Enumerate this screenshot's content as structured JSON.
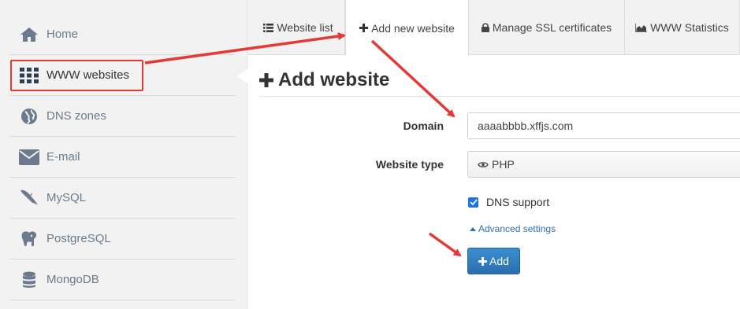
{
  "sidebar": {
    "items": [
      {
        "label": "Home",
        "icon": "home-icon"
      },
      {
        "label": "WWW websites",
        "icon": "grid-icon",
        "active": true
      },
      {
        "label": "DNS zones",
        "icon": "globe-icon"
      },
      {
        "label": "E-mail",
        "icon": "envelope-icon"
      },
      {
        "label": "MySQL",
        "icon": "dolphin-icon"
      },
      {
        "label": "PostgreSQL",
        "icon": "elephant-icon"
      },
      {
        "label": "MongoDB",
        "icon": "database-icon"
      }
    ]
  },
  "tabs": [
    {
      "label": "Website list",
      "icon": "list-icon"
    },
    {
      "label": "Add new website",
      "icon": "plus-icon",
      "active": true
    },
    {
      "label": "Manage SSL certificates",
      "icon": "lock-icon"
    },
    {
      "label": "WWW Statistics",
      "icon": "area-chart-icon"
    }
  ],
  "main": {
    "title": "Add website",
    "domain_label": "Domain",
    "domain_value": "aaaabbbb.xffjs.com",
    "website_type_label": "Website type",
    "website_type_value": "PHP",
    "dns_support_label": "DNS support",
    "dns_support_checked": true,
    "advanced_settings_label": "Advanced settings",
    "add_button_label": "Add"
  },
  "colors": {
    "accent": "#2a6fb0",
    "highlight": "#e53935",
    "sidebar_bg": "#f2f2f2"
  }
}
